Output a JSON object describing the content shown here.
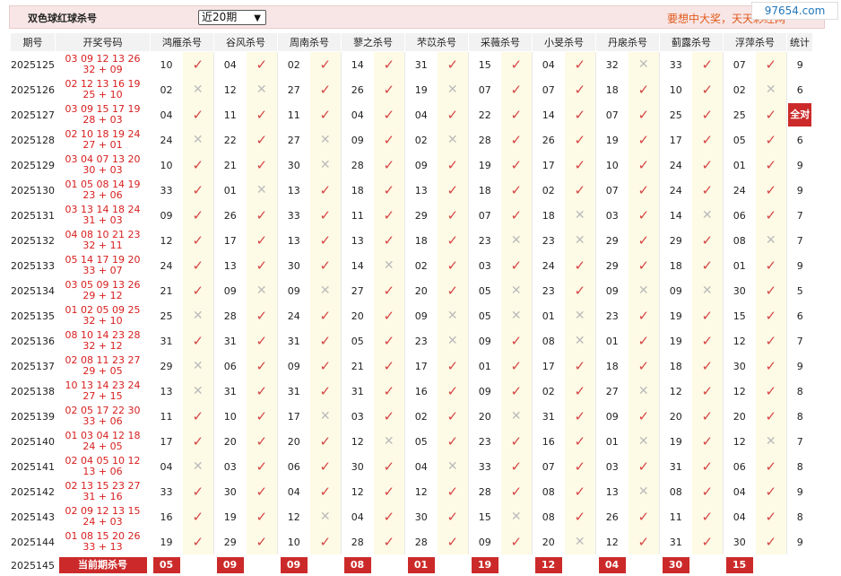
{
  "header": {
    "title": "双色球红球杀号",
    "select_value": "近20期",
    "slogan": "要想中大奖，天天彩经网",
    "watermark": "97654.com"
  },
  "columns": {
    "period": "期号",
    "numbers": "开奖号码",
    "experts": [
      "鸿雁杀号",
      "谷风杀号",
      "周南杀号",
      "蓼之杀号",
      "芣苡杀号",
      "采薇杀号",
      "小旻杀号",
      "丹扆杀号",
      "蓟露杀号",
      "浮萍杀号"
    ],
    "stat": "统计"
  },
  "icons": {
    "ok": "check-icon",
    "bad": "cross-icon"
  },
  "colors": {
    "accent": "#cc2a2a",
    "draw_numbers": "#d81e1e",
    "check": "#d64545",
    "mark_bg": "#fdfbe6"
  },
  "rows": [
    {
      "period": "2025125",
      "red": "03 09 12 13 26",
      "blue": "32 + 09",
      "picks": [
        "10",
        "04",
        "02",
        "14",
        "31",
        "15",
        "04",
        "32",
        "33",
        "07"
      ],
      "hits": [
        1,
        1,
        1,
        1,
        1,
        1,
        1,
        0,
        1,
        1
      ],
      "stat": "9"
    },
    {
      "period": "2025126",
      "red": "02 12 13 16 19",
      "blue": "25 + 10",
      "picks": [
        "02",
        "12",
        "27",
        "26",
        "19",
        "07",
        "07",
        "18",
        "10",
        "02"
      ],
      "hits": [
        0,
        0,
        1,
        1,
        0,
        1,
        1,
        1,
        1,
        0
      ],
      "stat": "6"
    },
    {
      "period": "2025127",
      "red": "03 09 15 17 19",
      "blue": "28 + 03",
      "picks": [
        "04",
        "11",
        "11",
        "04",
        "04",
        "22",
        "14",
        "07",
        "25",
        "25"
      ],
      "hits": [
        1,
        1,
        1,
        1,
        1,
        1,
        1,
        1,
        1,
        1
      ],
      "stat": "全对"
    },
    {
      "period": "2025128",
      "red": "02 10 18 19 24",
      "blue": "27 + 01",
      "picks": [
        "24",
        "22",
        "27",
        "09",
        "02",
        "28",
        "26",
        "19",
        "17",
        "05"
      ],
      "hits": [
        0,
        1,
        0,
        1,
        0,
        1,
        1,
        1,
        1,
        1
      ],
      "stat": "6"
    },
    {
      "period": "2025129",
      "red": "03 04 07 13 20",
      "blue": "30 + 03",
      "picks": [
        "10",
        "21",
        "30",
        "28",
        "09",
        "19",
        "17",
        "10",
        "24",
        "01"
      ],
      "hits": [
        1,
        1,
        0,
        1,
        1,
        1,
        1,
        1,
        1,
        1
      ],
      "stat": "9"
    },
    {
      "period": "2025130",
      "red": "01 05 08 14 19",
      "blue": "23 + 06",
      "picks": [
        "33",
        "01",
        "13",
        "18",
        "13",
        "18",
        "02",
        "07",
        "24",
        "24"
      ],
      "hits": [
        1,
        0,
        1,
        1,
        1,
        1,
        1,
        1,
        1,
        1
      ],
      "stat": "9"
    },
    {
      "period": "2025131",
      "red": "03 13 14 18 24",
      "blue": "31 + 03",
      "picks": [
        "09",
        "26",
        "33",
        "11",
        "29",
        "07",
        "18",
        "03",
        "14",
        "06"
      ],
      "hits": [
        1,
        1,
        1,
        1,
        1,
        1,
        0,
        1,
        0,
        1
      ],
      "stat": "7"
    },
    {
      "period": "2025132",
      "red": "04 08 10 21 23",
      "blue": "32 + 11",
      "picks": [
        "12",
        "17",
        "13",
        "13",
        "18",
        "23",
        "23",
        "29",
        "29",
        "08"
      ],
      "hits": [
        1,
        1,
        1,
        1,
        1,
        0,
        0,
        1,
        1,
        0
      ],
      "stat": "7"
    },
    {
      "period": "2025133",
      "red": "05 14 17 19 20",
      "blue": "33 + 07",
      "picks": [
        "24",
        "13",
        "30",
        "14",
        "02",
        "03",
        "24",
        "29",
        "18",
        "01"
      ],
      "hits": [
        1,
        1,
        1,
        0,
        1,
        1,
        1,
        1,
        1,
        1
      ],
      "stat": "9"
    },
    {
      "period": "2025134",
      "red": "03 05 09 13 26",
      "blue": "29 + 12",
      "picks": [
        "21",
        "09",
        "09",
        "27",
        "20",
        "05",
        "23",
        "09",
        "09",
        "30"
      ],
      "hits": [
        1,
        0,
        0,
        1,
        1,
        0,
        1,
        0,
        0,
        1
      ],
      "stat": "5"
    },
    {
      "period": "2025135",
      "red": "01 02 05 09 25",
      "blue": "32 + 10",
      "picks": [
        "25",
        "28",
        "24",
        "20",
        "09",
        "05",
        "01",
        "23",
        "19",
        "15"
      ],
      "hits": [
        0,
        1,
        1,
        1,
        0,
        0,
        0,
        1,
        1,
        1
      ],
      "stat": "6"
    },
    {
      "period": "2025136",
      "red": "08 10 14 23 28",
      "blue": "32 + 12",
      "picks": [
        "31",
        "31",
        "31",
        "05",
        "23",
        "09",
        "08",
        "01",
        "19",
        "12"
      ],
      "hits": [
        1,
        1,
        1,
        1,
        0,
        1,
        0,
        1,
        1,
        1
      ],
      "stat": "7"
    },
    {
      "period": "2025137",
      "red": "02 08 11 23 27",
      "blue": "29 + 05",
      "picks": [
        "29",
        "06",
        "09",
        "21",
        "17",
        "01",
        "17",
        "18",
        "18",
        "30"
      ],
      "hits": [
        0,
        1,
        1,
        1,
        1,
        1,
        1,
        1,
        1,
        1
      ],
      "stat": "9"
    },
    {
      "period": "2025138",
      "red": "10 13 14 23 24",
      "blue": "27 + 15",
      "picks": [
        "13",
        "31",
        "31",
        "31",
        "16",
        "09",
        "02",
        "27",
        "12",
        "12"
      ],
      "hits": [
        0,
        1,
        1,
        1,
        1,
        1,
        1,
        0,
        1,
        1
      ],
      "stat": "8"
    },
    {
      "period": "2025139",
      "red": "02 05 17 22 30",
      "blue": "33 + 06",
      "picks": [
        "11",
        "10",
        "17",
        "03",
        "02",
        "20",
        "31",
        "09",
        "20",
        "20"
      ],
      "hits": [
        1,
        1,
        0,
        1,
        1,
        0,
        1,
        1,
        1,
        1
      ],
      "stat": "8"
    },
    {
      "period": "2025140",
      "red": "01 03 04 12 18",
      "blue": "24 + 05",
      "picks": [
        "17",
        "20",
        "20",
        "12",
        "05",
        "23",
        "16",
        "01",
        "19",
        "12"
      ],
      "hits": [
        1,
        1,
        1,
        0,
        1,
        1,
        1,
        0,
        1,
        0
      ],
      "stat": "7"
    },
    {
      "period": "2025141",
      "red": "02 04 05 10 12",
      "blue": "13 + 06",
      "picks": [
        "04",
        "03",
        "06",
        "30",
        "04",
        "33",
        "07",
        "03",
        "31",
        "06"
      ],
      "hits": [
        0,
        1,
        1,
        1,
        0,
        1,
        1,
        1,
        1,
        1
      ],
      "stat": "8"
    },
    {
      "period": "2025142",
      "red": "02 13 15 23 27",
      "blue": "31 + 16",
      "picks": [
        "33",
        "30",
        "04",
        "12",
        "12",
        "28",
        "08",
        "13",
        "08",
        "04"
      ],
      "hits": [
        1,
        1,
        1,
        1,
        1,
        1,
        1,
        0,
        1,
        1
      ],
      "stat": "9"
    },
    {
      "period": "2025143",
      "red": "02 09 12 13 15",
      "blue": "24 + 03",
      "picks": [
        "16",
        "19",
        "12",
        "04",
        "30",
        "15",
        "08",
        "26",
        "11",
        "04"
      ],
      "hits": [
        1,
        1,
        0,
        1,
        1,
        0,
        1,
        1,
        1,
        1
      ],
      "stat": "8"
    },
    {
      "period": "2025144",
      "red": "01 08 15 20 26",
      "blue": "33 + 13",
      "picks": [
        "19",
        "29",
        "10",
        "28",
        "28",
        "09",
        "20",
        "12",
        "31",
        "30"
      ],
      "hits": [
        1,
        1,
        1,
        1,
        1,
        1,
        0,
        1,
        1,
        1
      ],
      "stat": "9"
    }
  ],
  "current": {
    "period": "2025145",
    "label": "当前期杀号",
    "picks": [
      "05",
      "09",
      "09",
      "08",
      "01",
      "19",
      "12",
      "04",
      "30",
      "15"
    ]
  }
}
